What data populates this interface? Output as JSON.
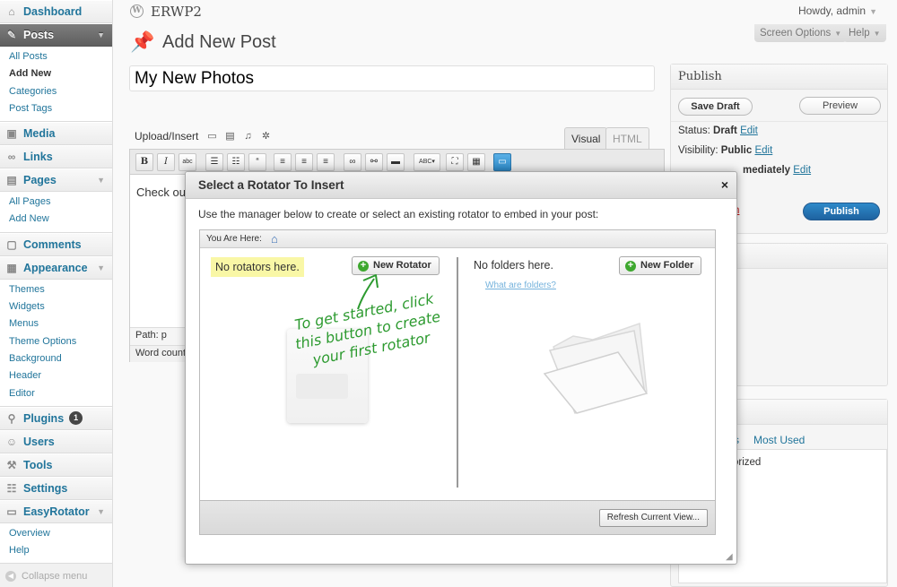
{
  "site": {
    "name": "ERWP2",
    "howdy": "Howdy, admin"
  },
  "header": {
    "screen_options": "Screen Options",
    "help": "Help"
  },
  "menu": {
    "dashboard": "Dashboard",
    "posts": "Posts",
    "posts_sub": [
      "All Posts",
      "Add New",
      "Categories",
      "Post Tags"
    ],
    "media": "Media",
    "links": "Links",
    "pages": "Pages",
    "pages_sub": [
      "All Pages",
      "Add New"
    ],
    "comments": "Comments",
    "appearance": "Appearance",
    "appearance_sub": [
      "Themes",
      "Widgets",
      "Menus",
      "Theme Options",
      "Background",
      "Header",
      "Editor"
    ],
    "plugins": "Plugins",
    "plugins_badge": "1",
    "users": "Users",
    "tools": "Tools",
    "settings": "Settings",
    "easyrotator": "EasyRotator",
    "easyrotator_sub": [
      "Overview",
      "Help"
    ],
    "collapse": "Collapse menu"
  },
  "page": {
    "title": "Add New Post",
    "post_title": "My New Photos"
  },
  "editor": {
    "upload_insert": "Upload/Insert",
    "tab_visual": "Visual",
    "tab_html": "HTML",
    "content": "Check ou",
    "path": "Path: p",
    "word_count": "Word count:"
  },
  "publish": {
    "title": "Publish",
    "save_draft": "Save Draft",
    "preview": "Preview",
    "status_label": "Status:",
    "status_value": "Draft",
    "visibility_label": "Visibility:",
    "visibility_value": "Public",
    "edit": "Edit",
    "publish_partial": "mediately",
    "trash_partial": "n",
    "publish_button": "Publish"
  },
  "categories": {
    "tab_partial": "s",
    "tab_most_used": "Most Used",
    "item_partial": "orized"
  },
  "modal": {
    "title": "Select a Rotator To Insert",
    "close": "×",
    "description": "Use the manager below to create or select an existing rotator to embed in your post:",
    "breadcrumb_label": "You Are Here:",
    "no_rotators": "No rotators here.",
    "new_rotator": "New Rotator",
    "no_folders": "No folders here.",
    "new_folder": "New Folder",
    "what_folders": "What are folders?",
    "hint": "To get started, click this button to create your first rotator",
    "refresh": "Refresh Current View..."
  },
  "colors": {
    "link": "#21759b",
    "primary": "#1e62a0",
    "hint": "#2c9a2f",
    "highlight": "#f9f7a6"
  }
}
